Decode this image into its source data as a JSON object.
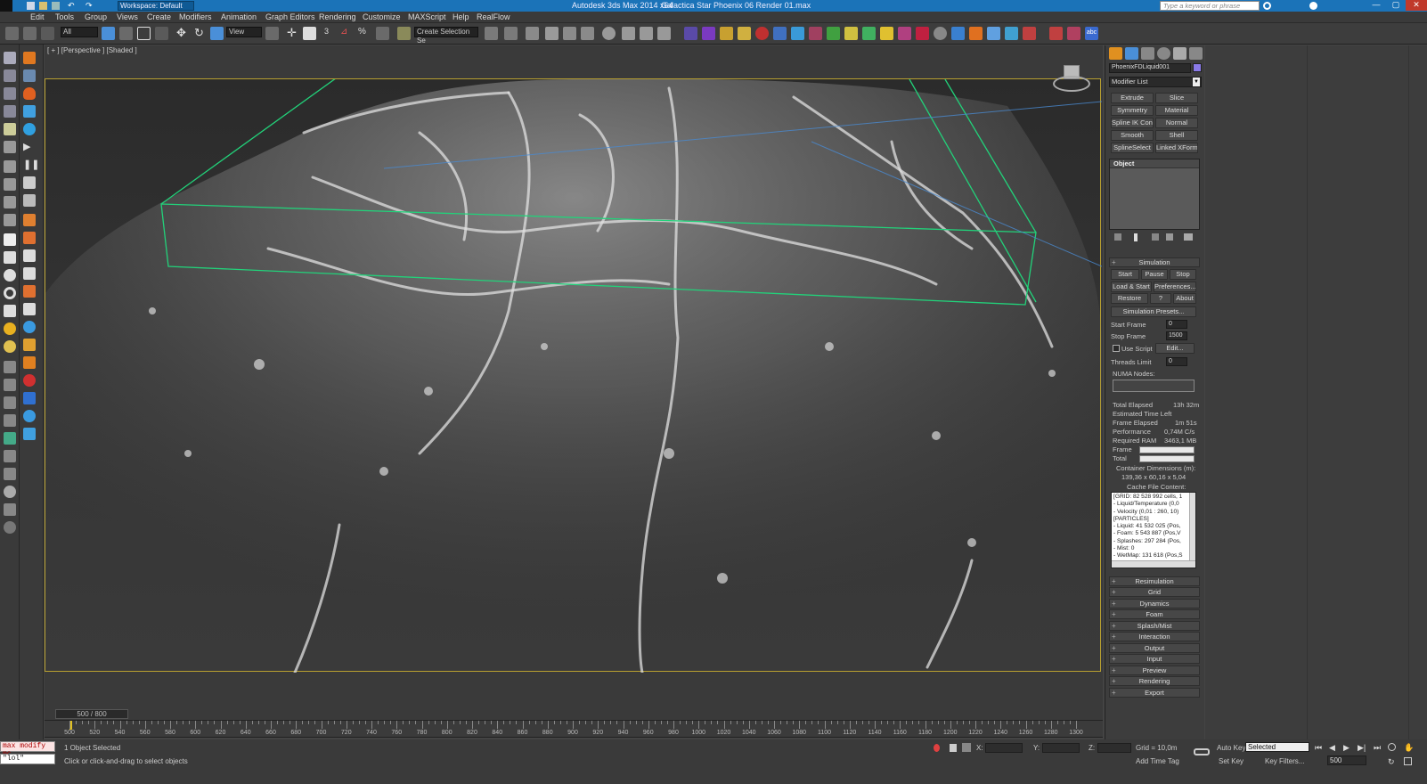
{
  "titlebar": {
    "workspace": "Workspace: Default",
    "app_title": "Autodesk 3ds Max  2014 x64",
    "file": "Galactica Star Phoenix 06 Render 01.max",
    "search_placeholder": "Type a keyword or phrase"
  },
  "menu": [
    "Edit",
    "Tools",
    "Group",
    "Views",
    "Create",
    "Modifiers",
    "Animation",
    "Graph Editors",
    "Rendering",
    "Customize",
    "MAXScript",
    "Help",
    "RealFlow"
  ],
  "toolbar": {
    "filter": "All",
    "ref_coord": "View",
    "sel_set": "Create Selection Se"
  },
  "viewport": {
    "label": "[ + ] [Perspective ] [Shaded ]"
  },
  "timeslider": {
    "frame": "500 / 800"
  },
  "ruler": {
    "ticks": [
      "500",
      "520",
      "540",
      "560",
      "580",
      "600",
      "620",
      "640",
      "660",
      "680",
      "700",
      "720",
      "740",
      "760",
      "780",
      "800",
      "820",
      "840",
      "860",
      "880",
      "900",
      "920",
      "940",
      "960",
      "980",
      "1000",
      "1020",
      "1040",
      "1060",
      "1080",
      "1100",
      "1120",
      "1140",
      "1160",
      "1180",
      "1200",
      "1220",
      "1240",
      "1260",
      "1280",
      "1300"
    ]
  },
  "status": {
    "listener_top": "max modify mc",
    "listener_bottom": "\"lol\"",
    "selected": "1 Object Selected",
    "prompt": "Click or click-and-drag to select objects",
    "x": "X:",
    "y": "Y:",
    "z": "Z:",
    "grid": "Grid = 10,0m",
    "add_time_tag": "Add Time Tag",
    "auto_key": "Auto Key",
    "set_key": "Set Key",
    "selected_mode": "Selected",
    "key_filters": "Key Filters...",
    "frame": "500"
  },
  "panel": {
    "object_name": "PhoenixFDLiquid001",
    "modifier_list": "Modifier List",
    "mod_buttons": [
      [
        "Extrude",
        "Slice"
      ],
      [
        "Symmetry",
        "Material"
      ],
      [
        "Spline IK Control",
        "Normal"
      ],
      [
        "Smooth",
        "Shell"
      ],
      [
        "SplineSelect",
        "Linked XForm"
      ]
    ],
    "stack_item": "Object",
    "simulation": {
      "title": "Simulation",
      "start": "Start",
      "pause": "Pause",
      "stop": "Stop",
      "load_start": "Load & Start",
      "preferences": "Preferences...",
      "restore": "Restore",
      "help": "?",
      "about": "About",
      "presets": "Simulation Presets...",
      "start_frame_label": "Start Frame",
      "start_frame": "0",
      "stop_frame_label": "Stop Frame",
      "stop_frame": "1500",
      "use_script": "Use Script",
      "edit": "Edit...",
      "threads_label": "Threads Limit",
      "threads": "0",
      "numa": "NUMA Nodes:",
      "total_elapsed_label": "Total Elapsed",
      "total_elapsed": "13h 32m",
      "est_left_label": "Estimated Time Left",
      "est_left": "",
      "frame_elapsed_label": "Frame Elapsed",
      "frame_elapsed": "1m 51s",
      "performance_label": "Performance",
      "performance": "0,74M C/s",
      "ram_label": "Required RAM",
      "ram": "3463,1 MB",
      "frame_label": "Frame",
      "total_label": "Total",
      "frame_progress": 0.0,
      "total_progress": 0.0,
      "container_label": "Container Dimensions (m):",
      "container": "139,36 x 60,16 x 5,04",
      "cache_label": "Cache File Content:",
      "cache_lines": [
        "[GRID: 82 528 992 cells, 1",
        "- Liquid/Temperature (0,0",
        "- Velocity (0,01 : 260, 10)",
        "[PARTICLES]",
        "- Liquid: 41 532 025 (Pos,",
        "- Foam: 5 543 887 (Pos,V",
        "- Splashes: 297 284 (Pos,",
        "- Mist: 0",
        "- WetMap: 131 618 (Pos,S"
      ]
    },
    "rollouts": [
      "Resimulation",
      "Grid",
      "Dynamics",
      "Foam",
      "Splash/Mist",
      "Interaction",
      "Output",
      "Input",
      "Preview",
      "Rendering",
      "Export"
    ]
  },
  "colors": {
    "titlebar": "#1b73b8",
    "accent": "#ff9a1a",
    "bbox": "#22d27a",
    "selection": "#b8a030"
  }
}
